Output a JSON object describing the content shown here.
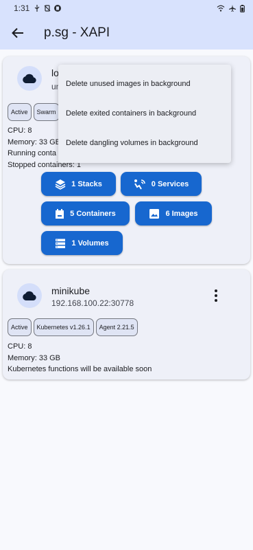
{
  "status_bar": {
    "time": "1:31"
  },
  "app_bar": {
    "title": "p.sg - XAPI"
  },
  "environments": [
    {
      "name": "lo",
      "url": "un",
      "chips": [
        "Active",
        "Swarm"
      ],
      "info": {
        "cpu": "CPU:  8",
        "memory": "Memory:  33 GB",
        "running": "Running conta",
        "stopped": "Stopped containers:  1"
      },
      "actions": {
        "stacks": "1 Stacks",
        "services": "0 Services",
        "containers": "5 Containers",
        "images": "6 Images",
        "volumes": "1 Volumes"
      }
    },
    {
      "name": "minikube",
      "url": "192.168.100.22:30778",
      "chips": [
        "Active",
        "Kubernetes v1.26.1",
        "Agent 2.21.5"
      ],
      "info": {
        "cpu": "CPU:  8",
        "memory": "Memory:  33 GB",
        "note": "Kubernetes functions will be available soon"
      }
    }
  ],
  "context_menu": {
    "items": [
      "Delete unused images in background",
      "Delete exited containers in background",
      "Delete dangling volumes in background"
    ]
  },
  "colors": {
    "app_bar": "#d8e2fd",
    "accent": "#1767cf",
    "card": "#eef0f8"
  }
}
